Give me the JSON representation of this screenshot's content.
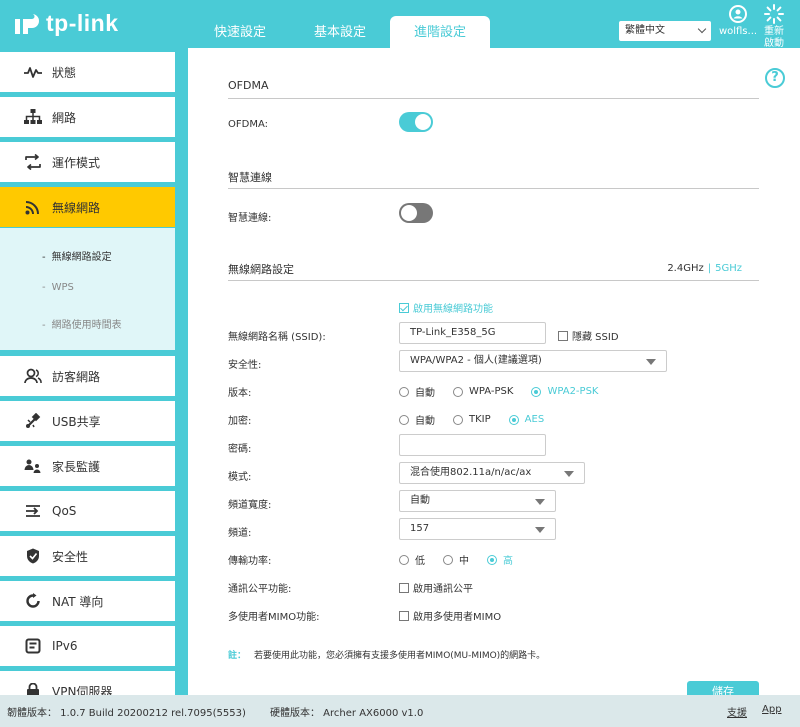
{
  "brand": {
    "logo_text": "tp-link"
  },
  "tabs": [
    {
      "label": "快速設定"
    },
    {
      "label": "基本設定"
    },
    {
      "label": "進階設定"
    }
  ],
  "header": {
    "language": "繁體中文",
    "user_label": "wolfls...",
    "reboot_label": "重新啟動"
  },
  "sidebar": {
    "items": [
      {
        "label": "狀態",
        "icon": "pulse-icon"
      },
      {
        "label": "網路",
        "icon": "network-icon"
      },
      {
        "label": "運作模式",
        "icon": "mode-icon"
      },
      {
        "label": "無線網路",
        "icon": "wifi-icon"
      },
      {
        "label": "訪客網路",
        "icon": "guest-icon"
      },
      {
        "label": "USB共享",
        "icon": "usb-icon"
      },
      {
        "label": "家長監護",
        "icon": "parental-icon"
      },
      {
        "label": "QoS",
        "icon": "qos-icon"
      },
      {
        "label": "安全性",
        "icon": "shield-icon"
      },
      {
        "label": "NAT 導向",
        "icon": "nat-icon"
      },
      {
        "label": "IPv6",
        "icon": "ipv6-icon"
      },
      {
        "label": "VPN伺服器",
        "icon": "vpn-icon"
      }
    ],
    "subitems": [
      {
        "label": "無線網路設定"
      },
      {
        "label": "WPS"
      },
      {
        "label": "網路使用時間表"
      }
    ]
  },
  "ofdma": {
    "section_title": "OFDMA",
    "label": "OFDMA:",
    "enabled": true
  },
  "smart_connect": {
    "section_title": "智慧連線",
    "label": "智慧連線:",
    "enabled": false
  },
  "wireless": {
    "section_title": "無線網路設定",
    "band_24": "2.4GHz",
    "band_sep": "|",
    "band_5": "5GHz",
    "enable_label": "啟用無線網路功能",
    "ssid_label": "無線網路名稱 (SSID):",
    "ssid_value": "TP-Link_E358_5G",
    "hide_ssid_label": "隱藏 SSID",
    "security_label": "安全性:",
    "security_value": "WPA/WPA2 - 個人(建議選項)",
    "version_label": "版本:",
    "version_options": [
      "自動",
      "WPA-PSK",
      "WPA2-PSK"
    ],
    "encryption_label": "加密:",
    "encryption_options": [
      "自動",
      "TKIP",
      "AES"
    ],
    "password_label": "密碼:",
    "password_value": "",
    "mode_label": "模式:",
    "mode_value": "混合使用802.11a/n/ac/ax",
    "width_label": "頻道寬度:",
    "width_value": "自動",
    "channel_label": "頻道:",
    "channel_value": "157",
    "power_label": "傳輸功率:",
    "power_options": [
      "低",
      "中",
      "高"
    ],
    "airtime_label": "通訊公平功能:",
    "airtime_option": "啟用通訊公平",
    "mumimo_label": "多使用者MIMO功能:",
    "mumimo_option": "啟用多使用者MIMO",
    "note_label": "註：",
    "note_text": "若要使用此功能，您必須擁有支援多使用者MIMO(MU-MIMO)的網路卡。",
    "save_label": "儲存"
  },
  "footer": {
    "firmware": "韌體版本： 1.0.7 Build 20200212 rel.7095(5553)",
    "hardware": "硬體版本： Archer AX6000 v1.0",
    "support": "支援",
    "app": "App"
  },
  "colors": {
    "accent": "#4acbd6",
    "active_nav": "#ffc900",
    "subnav_bg": "#e0f6f8"
  }
}
